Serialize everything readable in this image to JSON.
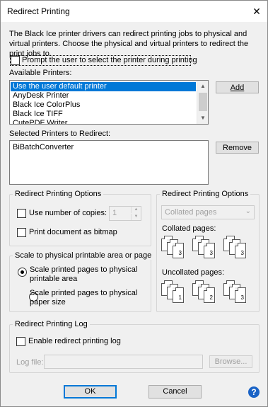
{
  "window": {
    "title": "Redirect Printing",
    "close_symbol": "✕"
  },
  "description": "The Black Ice printer drivers can redirect printing jobs to physical and virtual printers. Choose the physical and virtual printers to redirect the print jobs to.",
  "prompt_checkbox": {
    "label": "Prompt the user to select the printer during printing",
    "checked": false
  },
  "available_printers": {
    "label": "Available Printers:",
    "items": [
      "Use the user default printer",
      "AnyDesk Printer",
      "Black Ice ColorPlus",
      "Black Ice TIFF",
      "CutePDF Writer"
    ],
    "selected_index": 0,
    "add_label": "Add"
  },
  "selected_printers": {
    "label": "Selected Printers to Redirect:",
    "items": [
      "BiBatchConverter"
    ],
    "remove_label": "Remove"
  },
  "options_left": {
    "label": "Redirect Printing Options",
    "copies_label": "Use number of copies:",
    "copies_value": "1",
    "bitmap_label": "Print document as bitmap"
  },
  "scale": {
    "label": "Scale to physical printable area or page",
    "option1": "Scale printed pages to physical printable area",
    "option2": "Scale printed pages to physical paper size",
    "selected": 1
  },
  "options_right": {
    "label": "Redirect Printing Options",
    "select_value": "Collated pages",
    "collated_label": "Collated pages:",
    "uncollated_label": "Uncollated pages:",
    "collated_sets": [
      [
        "1",
        "2",
        "3"
      ],
      [
        "1",
        "2",
        "3"
      ],
      [
        "1",
        "2",
        "3"
      ]
    ],
    "uncollated_sets": [
      [
        "1",
        "1",
        "1"
      ],
      [
        "2",
        "2",
        "2"
      ],
      [
        "3",
        "3",
        "3"
      ]
    ]
  },
  "log": {
    "label": "Redirect Printing Log",
    "enable_label": "Enable redirect printing log",
    "file_label": "Log file:",
    "file_value": "",
    "browse_label": "Browse..."
  },
  "footer": {
    "ok_label": "OK",
    "cancel_label": "Cancel",
    "help_symbol": "?"
  },
  "colors": {
    "accent": "#0078d7",
    "help": "#1a63c6"
  }
}
